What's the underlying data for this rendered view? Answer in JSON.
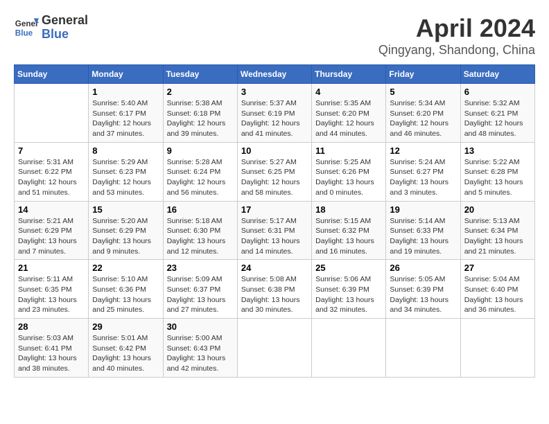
{
  "header": {
    "logo_line1": "General",
    "logo_line2": "Blue",
    "title": "April 2024",
    "subtitle": "Qingyang, Shandong, China"
  },
  "calendar": {
    "days_of_week": [
      "Sunday",
      "Monday",
      "Tuesday",
      "Wednesday",
      "Thursday",
      "Friday",
      "Saturday"
    ],
    "weeks": [
      [
        {
          "day": "",
          "info": ""
        },
        {
          "day": "1",
          "info": "Sunrise: 5:40 AM\nSunset: 6:17 PM\nDaylight: 12 hours\nand 37 minutes."
        },
        {
          "day": "2",
          "info": "Sunrise: 5:38 AM\nSunset: 6:18 PM\nDaylight: 12 hours\nand 39 minutes."
        },
        {
          "day": "3",
          "info": "Sunrise: 5:37 AM\nSunset: 6:19 PM\nDaylight: 12 hours\nand 41 minutes."
        },
        {
          "day": "4",
          "info": "Sunrise: 5:35 AM\nSunset: 6:20 PM\nDaylight: 12 hours\nand 44 minutes."
        },
        {
          "day": "5",
          "info": "Sunrise: 5:34 AM\nSunset: 6:20 PM\nDaylight: 12 hours\nand 46 minutes."
        },
        {
          "day": "6",
          "info": "Sunrise: 5:32 AM\nSunset: 6:21 PM\nDaylight: 12 hours\nand 48 minutes."
        }
      ],
      [
        {
          "day": "7",
          "info": "Sunrise: 5:31 AM\nSunset: 6:22 PM\nDaylight: 12 hours\nand 51 minutes."
        },
        {
          "day": "8",
          "info": "Sunrise: 5:29 AM\nSunset: 6:23 PM\nDaylight: 12 hours\nand 53 minutes."
        },
        {
          "day": "9",
          "info": "Sunrise: 5:28 AM\nSunset: 6:24 PM\nDaylight: 12 hours\nand 56 minutes."
        },
        {
          "day": "10",
          "info": "Sunrise: 5:27 AM\nSunset: 6:25 PM\nDaylight: 12 hours\nand 58 minutes."
        },
        {
          "day": "11",
          "info": "Sunrise: 5:25 AM\nSunset: 6:26 PM\nDaylight: 13 hours\nand 0 minutes."
        },
        {
          "day": "12",
          "info": "Sunrise: 5:24 AM\nSunset: 6:27 PM\nDaylight: 13 hours\nand 3 minutes."
        },
        {
          "day": "13",
          "info": "Sunrise: 5:22 AM\nSunset: 6:28 PM\nDaylight: 13 hours\nand 5 minutes."
        }
      ],
      [
        {
          "day": "14",
          "info": "Sunrise: 5:21 AM\nSunset: 6:29 PM\nDaylight: 13 hours\nand 7 minutes."
        },
        {
          "day": "15",
          "info": "Sunrise: 5:20 AM\nSunset: 6:29 PM\nDaylight: 13 hours\nand 9 minutes."
        },
        {
          "day": "16",
          "info": "Sunrise: 5:18 AM\nSunset: 6:30 PM\nDaylight: 13 hours\nand 12 minutes."
        },
        {
          "day": "17",
          "info": "Sunrise: 5:17 AM\nSunset: 6:31 PM\nDaylight: 13 hours\nand 14 minutes."
        },
        {
          "day": "18",
          "info": "Sunrise: 5:15 AM\nSunset: 6:32 PM\nDaylight: 13 hours\nand 16 minutes."
        },
        {
          "day": "19",
          "info": "Sunrise: 5:14 AM\nSunset: 6:33 PM\nDaylight: 13 hours\nand 19 minutes."
        },
        {
          "day": "20",
          "info": "Sunrise: 5:13 AM\nSunset: 6:34 PM\nDaylight: 13 hours\nand 21 minutes."
        }
      ],
      [
        {
          "day": "21",
          "info": "Sunrise: 5:11 AM\nSunset: 6:35 PM\nDaylight: 13 hours\nand 23 minutes."
        },
        {
          "day": "22",
          "info": "Sunrise: 5:10 AM\nSunset: 6:36 PM\nDaylight: 13 hours\nand 25 minutes."
        },
        {
          "day": "23",
          "info": "Sunrise: 5:09 AM\nSunset: 6:37 PM\nDaylight: 13 hours\nand 27 minutes."
        },
        {
          "day": "24",
          "info": "Sunrise: 5:08 AM\nSunset: 6:38 PM\nDaylight: 13 hours\nand 30 minutes."
        },
        {
          "day": "25",
          "info": "Sunrise: 5:06 AM\nSunset: 6:39 PM\nDaylight: 13 hours\nand 32 minutes."
        },
        {
          "day": "26",
          "info": "Sunrise: 5:05 AM\nSunset: 6:39 PM\nDaylight: 13 hours\nand 34 minutes."
        },
        {
          "day": "27",
          "info": "Sunrise: 5:04 AM\nSunset: 6:40 PM\nDaylight: 13 hours\nand 36 minutes."
        }
      ],
      [
        {
          "day": "28",
          "info": "Sunrise: 5:03 AM\nSunset: 6:41 PM\nDaylight: 13 hours\nand 38 minutes."
        },
        {
          "day": "29",
          "info": "Sunrise: 5:01 AM\nSunset: 6:42 PM\nDaylight: 13 hours\nand 40 minutes."
        },
        {
          "day": "30",
          "info": "Sunrise: 5:00 AM\nSunset: 6:43 PM\nDaylight: 13 hours\nand 42 minutes."
        },
        {
          "day": "",
          "info": ""
        },
        {
          "day": "",
          "info": ""
        },
        {
          "day": "",
          "info": ""
        },
        {
          "day": "",
          "info": ""
        }
      ]
    ]
  }
}
